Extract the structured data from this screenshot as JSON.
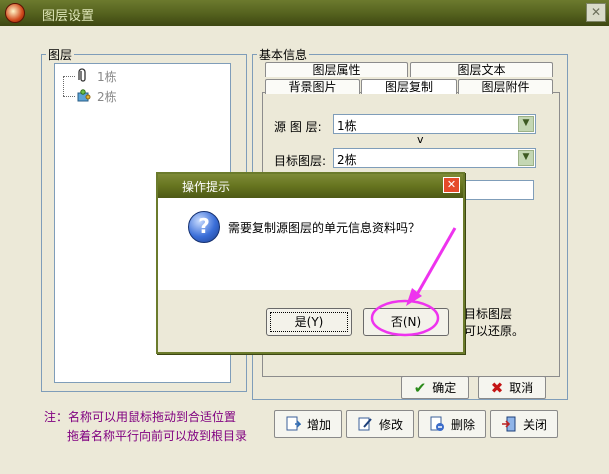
{
  "window": {
    "title": "图层设置",
    "close_glyph": "✕"
  },
  "layer_panel": {
    "legend": "图层",
    "items": [
      {
        "label": "1栋",
        "icon": "paperclip-icon"
      },
      {
        "label": "2栋",
        "icon": "puzzle-icon"
      }
    ]
  },
  "info_panel": {
    "legend": "基本信息",
    "tabs_row1": [
      "图层属性",
      "图层文本"
    ],
    "tabs_row2": [
      "背景图片",
      "图层复制",
      "图层附件"
    ],
    "source_label": "源 图 层:",
    "source_value": "1栋",
    "arrow_text": "v",
    "target_label": "目标图层:",
    "target_value": "2栋",
    "hint_line1": "目标图层",
    "hint_line2": "可以还原。",
    "ok_label": "确定",
    "cancel_label": "取消"
  },
  "footer": {
    "note_line1": "注：名称可以用鼠标拖动到合适位置",
    "note_line2": "拖着名称平行向前可以放到根目录",
    "add_label": "增加",
    "edit_label": "修改",
    "delete_label": "删除",
    "close_label": "关闭"
  },
  "dialog": {
    "title": "操作提示",
    "close_glyph": "✕",
    "icon_glyph": "?",
    "message": "需要复制源图层的单元信息资料吗？",
    "yes_label": "是(Y)",
    "no_label": "否(N)"
  },
  "colors": {
    "accent_olive": "#5f6d22",
    "highlight_magenta": "#ee33ee",
    "note_text": "#800080"
  }
}
